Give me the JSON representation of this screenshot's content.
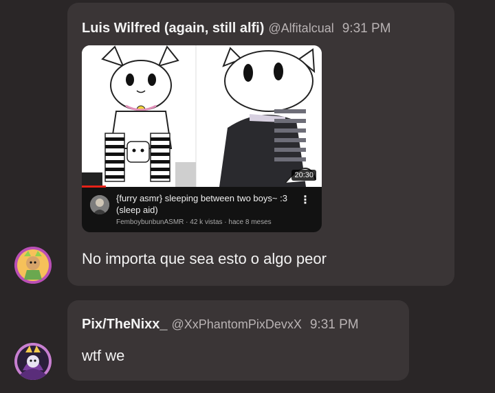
{
  "messages": [
    {
      "author": "Luis Wilfred (again, still alfi)",
      "handle": "@Alfitalcual",
      "time": "9:31 PM",
      "text": "No importa que sea esto o algo peor",
      "embed": {
        "video_title": "{furry asmr} sleeping between two boys~ :3 (sleep aid)",
        "meta": "FemboybunbunASMR · 42 k vistas · hace 8 meses",
        "duration": "20:30",
        "progress": 0.1
      }
    },
    {
      "author": "Pix/TheNixx_",
      "handle": "@XxPhantomPixDevxX",
      "time": "9:31 PM",
      "text": "wtf we"
    }
  ],
  "colors": {
    "background": "#2a2627",
    "bubble": "#3a3536",
    "progress": "#e62117"
  }
}
